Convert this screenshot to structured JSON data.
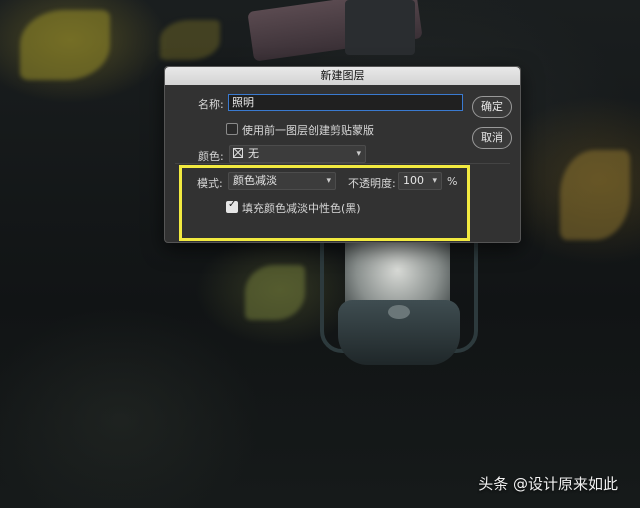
{
  "dialog": {
    "title": "新建图层",
    "name_label": "名称:",
    "name_value": "照明",
    "ok_button": "确定",
    "cancel_button": "取消",
    "clipping_mask_label": "使用前一图层创建剪贴蒙版",
    "clipping_mask_checked": false,
    "color_label": "颜色:",
    "color_value": "无",
    "mode_label": "模式:",
    "mode_value": "颜色减淡",
    "opacity_label": "不透明度:",
    "opacity_value": "100",
    "opacity_unit": "%",
    "fill_neutral_label": "填充颜色减淡中性色(黑)",
    "fill_neutral_checked": true
  },
  "highlight_color": "#f2ea40",
  "watermark": "头条 @设计原来如此"
}
